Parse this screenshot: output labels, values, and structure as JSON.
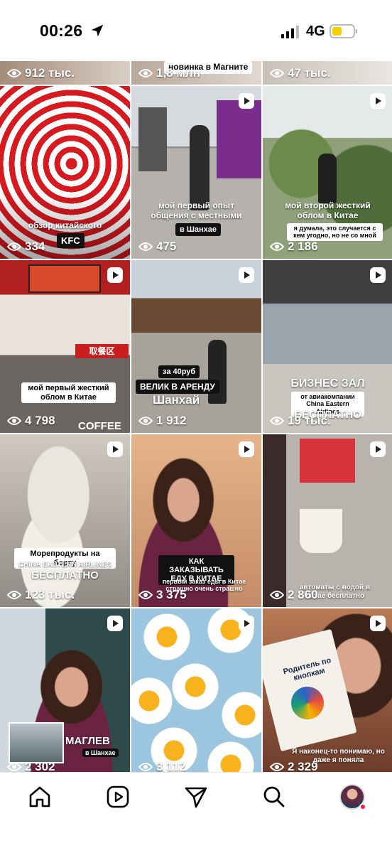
{
  "status_bar": {
    "time": "00:26",
    "network": "4G"
  },
  "top_strip": [
    {
      "views": "912 тыс."
    },
    {
      "views": "1,8 млн",
      "caption": "новинка в Магните"
    },
    {
      "views": "47 тыс."
    }
  ],
  "tiles": [
    {
      "views": "334",
      "caption": "обзор китайского",
      "badge": "KFC"
    },
    {
      "views": "475",
      "caption": "мой первый опыт общения с местными",
      "badge": "в Шанхае"
    },
    {
      "views": "2 186",
      "caption": "мой второй жесткий облом в Китае",
      "sub": "я думала, это случается с кем угодно, но не со мной"
    },
    {
      "views": "4 798",
      "caption": "мой первый жесткий облом в Китае",
      "sign": "取餐区",
      "coffee": "COFFEE"
    },
    {
      "views": "1 912",
      "label1": "за 40руб",
      "label2": "ВЕЛИК В АРЕНДУ",
      "label3": "Шанхай"
    },
    {
      "views": "19 тыс.",
      "title": "БИЗНЕС ЗАЛ",
      "sub": "от авиакомпании China Eastern Airlines",
      "title2": "БЕСПЛАТНО"
    },
    {
      "views": "123 тыс.",
      "caption": "Морепродукты на борту",
      "sub": "CHINA EASTERN AIRLINES",
      "title2": "БЕСПЛАТНО"
    },
    {
      "views": "3 375",
      "caption": "КАК ЗАКАЗЫВАТЬ ЕДУ В КИТАЕ",
      "sub": "первый заказ еды в Китае страшно очень страшно"
    },
    {
      "views": "2 860",
      "caption": "автоматы с водой в Китае бесплатно"
    },
    {
      "views": "2 302",
      "title": "МАГЛЕВ",
      "sub": "в Шанхае"
    },
    {
      "views": "3 112"
    },
    {
      "views": "2 329",
      "book": "Родитель по кнопкам",
      "caption": "Я наконец-то понимаю, но даже я поняла"
    }
  ],
  "colors": {
    "accent": "#ff1744",
    "battery": "#f5d000"
  },
  "nav": [
    "home-icon",
    "reels-icon",
    "send-icon",
    "search-icon",
    "profile-avatar"
  ]
}
